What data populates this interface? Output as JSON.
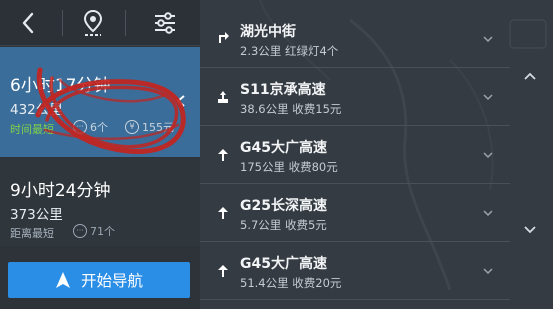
{
  "toolbar": {
    "back_label": "‹",
    "location_icon": "location-pin-icon",
    "settings_icon": "sliders-icon"
  },
  "routes": [
    {
      "time": "6小时17分钟",
      "distance": "432公里",
      "tag": "时间最短",
      "tag_color": "#7ed34a",
      "lights": "6个",
      "toll": "155元"
    },
    {
      "time": "9小时24分钟",
      "distance": "373公里",
      "tag": "距离最短",
      "tag_color": "#a9b4bf",
      "lights": "71个"
    }
  ],
  "start_button": {
    "label": "开始导航"
  },
  "steps": [
    {
      "name": "湖光中街",
      "info": "2.3公里 红绿灯4个",
      "icon": "turn-right-icon"
    },
    {
      "name": "S11京承高速",
      "info": "38.6公里 收费15元",
      "icon": "toll-gate-icon"
    },
    {
      "name": "G45大广高速",
      "info": "175公里 收费80元",
      "icon": "straight-arrow-icon"
    },
    {
      "name": "G25长深高速",
      "info": "5.7公里 收费5元",
      "icon": "straight-arrow-icon"
    },
    {
      "name": "G45大广高速",
      "info": "51.4公里 收费20元",
      "icon": "straight-arrow-icon"
    }
  ],
  "colors": {
    "selected_route": "#3b6d9a",
    "start_button": "#2b8ee6",
    "annotation": "#c4241e"
  }
}
